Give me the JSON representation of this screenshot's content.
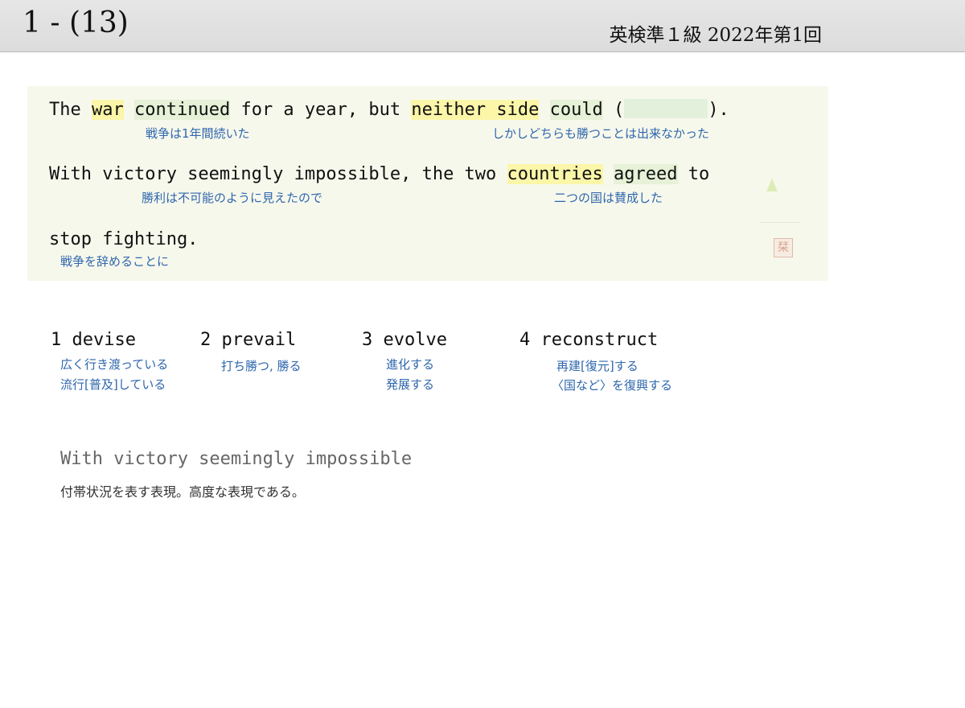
{
  "header": {
    "question_number": "1 - (13)",
    "exam_label": "英検準１級  2022年第1回"
  },
  "sentence": {
    "line1": {
      "t1": "The ",
      "w_war": "war",
      "t2": " ",
      "w_continued": "continued",
      "t3": " for a year, but ",
      "w_neither_side": "neither side",
      "t4": " ",
      "w_could": "could",
      "t5": " (",
      "t6": ")."
    },
    "line2": {
      "t1": "With victory seemingly impossible, the two ",
      "w_countries": "countries",
      "t2": " ",
      "w_agreed": "agreed",
      "t3": " to"
    },
    "line3": "stop fighting.",
    "glosses": {
      "g1": "戦争は1年間続いた",
      "g2": "しかしどちらも勝つことは出来なかった",
      "g3": "勝利は不可能のように見えたので",
      "g4": "二つの国は賛成した",
      "g5": "戦争を辞めることに"
    },
    "stamp_char": "栞"
  },
  "choices": [
    {
      "label": "1 devise",
      "meanings": [
        "広く行き渡っている",
        "流行[普及]している"
      ]
    },
    {
      "label": "2 prevail",
      "meanings": [
        "打ち勝つ, 勝る"
      ]
    },
    {
      "label": "3 evolve",
      "meanings": [
        "進化する",
        "発展する"
      ]
    },
    {
      "label": "4 reconstruct",
      "meanings": [
        "再建[復元]する",
        "〈国など〉を復興する"
      ]
    }
  ],
  "note": {
    "phrase": "With victory seemingly impossible",
    "explanation": "付帯状況を表す表現。高度な表現である。"
  },
  "colors": {
    "highlight_yellow": "#fbf6a8",
    "highlight_green": "#e6f1d7",
    "gloss_blue": "#2f67ad",
    "panel_bg": "#f7f8ec"
  }
}
